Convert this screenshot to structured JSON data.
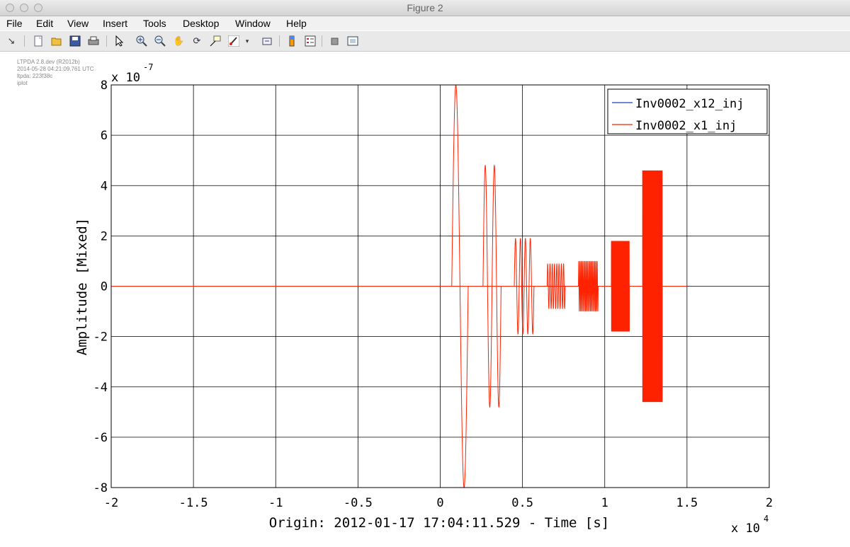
{
  "window": {
    "title": "Figure 2"
  },
  "menu": [
    "File",
    "Edit",
    "View",
    "Insert",
    "Tools",
    "Desktop",
    "Window",
    "Help"
  ],
  "toolbar": {
    "icons": [
      "edit-plot-arrow-icon",
      "new-figure-icon",
      "open-file-icon",
      "save-icon",
      "print-icon",
      "select-arrow-icon",
      "zoom-in-icon",
      "zoom-out-icon",
      "pan-hand-icon",
      "rotate-3d-icon",
      "data-cursor-icon",
      "brush-icon",
      "brush-dropdown-icon",
      "link-plot-icon",
      "colorbar-icon",
      "legend-icon",
      "hide-plot-tools-icon",
      "show-plot-tools-icon"
    ]
  },
  "metadata": [
    "LTPDA 2.8.dev (R2012b)",
    "2014-05-28 04:21:09.761 UTC",
    "ltpda: 223f38c",
    "iplot"
  ],
  "chart_data": {
    "type": "line",
    "xlabel": "Origin: 2012-01-17 17:04:11.529 - Time  [s]",
    "ylabel": "Amplitude  [Mixed]",
    "x_exponent_label": "x 10",
    "x_exponent": "4",
    "y_exponent_label": "x 10",
    "y_exponent": "-7",
    "xlim": [
      -20000,
      20000
    ],
    "ylim": [
      -8e-07,
      8e-07
    ],
    "xticks": [
      -20000,
      -15000,
      -10000,
      -5000,
      0,
      5000,
      10000,
      15000,
      20000
    ],
    "xtick_labels": [
      "-2",
      "-1.5",
      "-1",
      "-0.5",
      "0",
      "0.5",
      "1",
      "1.5",
      "2"
    ],
    "yticks": [
      -8e-07,
      -6e-07,
      -4e-07,
      -2e-07,
      0,
      2e-07,
      4e-07,
      6e-07,
      8e-07
    ],
    "ytick_labels": [
      "-8",
      "-6",
      "-4",
      "-2",
      "0",
      "2",
      "4",
      "6",
      "8"
    ],
    "grid": true,
    "legend_position": "top-right",
    "series": [
      {
        "name": "Inv0002_x12_inj",
        "color": "#1f3fbf",
        "x": [
          -20000,
          15000
        ],
        "y": [
          0,
          0
        ]
      },
      {
        "name": "Inv0002_x1_inj",
        "color": "#ff2200",
        "bursts": [
          {
            "x_start": 700,
            "x_end": 1700,
            "amplitude": 8e-07,
            "cycles": 1
          },
          {
            "x_start": 2600,
            "x_end": 3700,
            "amplitude": 4.8e-07,
            "cycles": 2
          },
          {
            "x_start": 4500,
            "x_end": 5700,
            "amplitude": 1.9e-07,
            "cycles": 4
          },
          {
            "x_start": 6500,
            "x_end": 7600,
            "amplitude": 9e-08,
            "cycles": 8
          },
          {
            "x_start": 8400,
            "x_end": 9600,
            "amplitude": 1e-07,
            "cycles": 16
          },
          {
            "x_start": 10400,
            "x_end": 11500,
            "amplitude": 1.8e-07,
            "cycles": 60
          },
          {
            "x_start": 12300,
            "x_end": 13500,
            "amplitude": 4.6e-07,
            "cycles": 120
          }
        ],
        "baseline": {
          "x_start": -20000,
          "x_end": 15000,
          "y": 0
        }
      }
    ]
  }
}
